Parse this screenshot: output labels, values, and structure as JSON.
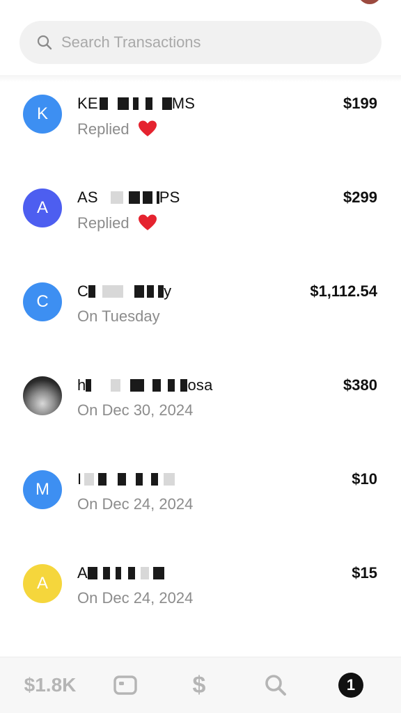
{
  "search": {
    "placeholder": "Search Transactions"
  },
  "transactions": [
    {
      "initial": "K",
      "avatar_color": "#3d8ff2",
      "name_prefix": "KE",
      "name_suffix": "MS",
      "status": "Replied",
      "reaction": "heart",
      "amount": "$199"
    },
    {
      "initial": "A",
      "avatar_color": "#4d5ef0",
      "name_prefix": "AS",
      "name_suffix": "PS",
      "status": "Replied",
      "reaction": "heart",
      "amount": "$299"
    },
    {
      "initial": "C",
      "avatar_color": "#3d8ff2",
      "name_prefix": "C",
      "name_suffix": "y",
      "status": "On Tuesday",
      "reaction": "",
      "amount": "$1,112.54"
    },
    {
      "initial": "",
      "avatar_color": "#2b2b2b",
      "name_prefix": "h",
      "name_suffix": "osa",
      "status": "On Dec 30, 2024",
      "reaction": "",
      "amount": "$380"
    },
    {
      "initial": "M",
      "avatar_color": "#3d8ff2",
      "name_prefix": "I",
      "name_suffix": "",
      "status": "On Dec 24, 2024",
      "reaction": "",
      "amount": "$10"
    },
    {
      "initial": "A",
      "avatar_color": "#f5d63c",
      "name_prefix": "A",
      "name_suffix": "",
      "status": "On Dec 24, 2024",
      "reaction": "",
      "amount": "$15"
    }
  ],
  "tabbar": {
    "balance": "$1.8K",
    "pay_symbol": "$",
    "activity_badge": "1"
  }
}
